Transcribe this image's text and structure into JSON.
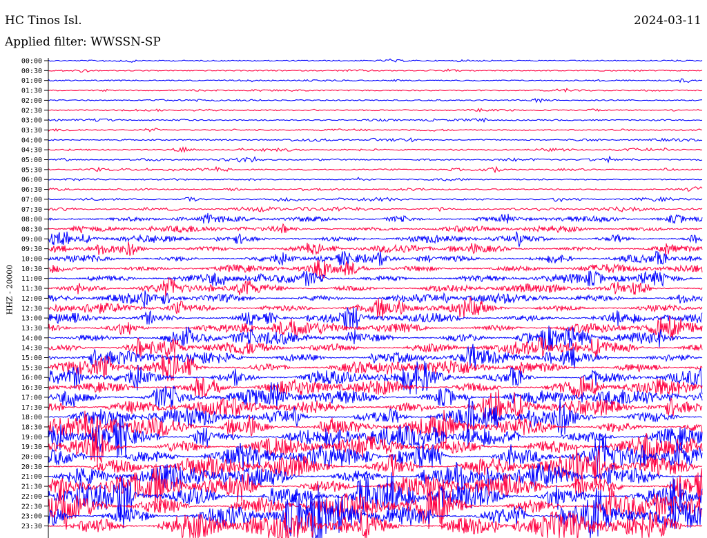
{
  "header": {
    "station": "HC Tinos Isl.",
    "date": "2024-03-11",
    "filter": "Applied filter: WWSSN-SP"
  },
  "chart_data": {
    "type": "line",
    "ylabel": "HHZ - 20000",
    "tick_labels": [
      "00:00",
      "00:30",
      "01:00",
      "01:30",
      "02:00",
      "02:30",
      "03:00",
      "03:30",
      "04:00",
      "04:30",
      "05:00",
      "05:30",
      "06:00",
      "06:30",
      "07:00",
      "07:30",
      "08:00",
      "08:30",
      "09:00",
      "09:30",
      "10:00",
      "10:30",
      "11:00",
      "11:30",
      "12:00",
      "12:30",
      "13:00",
      "13:30",
      "14:00",
      "14:30",
      "15:00",
      "15:30",
      "16:00",
      "16:30",
      "17:00",
      "17:30",
      "18:00",
      "18:30",
      "19:00",
      "19:30",
      "20:00",
      "20:30",
      "21:00",
      "21:30",
      "22:00",
      "22:30",
      "23:00",
      "23:30"
    ],
    "series_colors": [
      "#0000ff",
      "#ff0040"
    ],
    "trace_interval_minutes": 30,
    "activity_by_trace": [
      1,
      1,
      1,
      1,
      1,
      1,
      1.3,
      1.3,
      1.6,
      1.6,
      1.6,
      1.4,
      1.3,
      1.3,
      2,
      2.6,
      3.2,
      3.6,
      4,
      4.2,
      4.4,
      4.6,
      4.8,
      5,
      5.2,
      5.4,
      5.8,
      6.2,
      6.6,
      7,
      7.4,
      7.8,
      8.2,
      8.6,
      9,
      9.5,
      10,
      10.5,
      11,
      11.5,
      12,
      12.5,
      13,
      13.5,
      14,
      14.5,
      15,
      15.5
    ]
  }
}
